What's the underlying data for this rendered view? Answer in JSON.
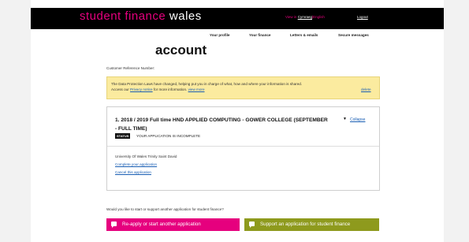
{
  "header": {
    "brand_student_finance": "student finance",
    "brand_wales": "wales",
    "lang_view_in": "View in",
    "lang_cymraeg": "Cymraeg",
    "lang_separator": "|",
    "lang_english": "English",
    "logout": "Logout"
  },
  "nav": {
    "items": [
      "Your profile",
      "Your finance",
      "Letters & emails",
      "Secure messages"
    ]
  },
  "page": {
    "title": "account",
    "crn_label": "Customer Reference Number:"
  },
  "notice": {
    "line1": "The Data Protection Laws have changed, helping put you in charge of what, how and where your information is shared.",
    "line2_prefix": "Access our",
    "privacy_link": "Privacy notice",
    "line2_mid": "for more information.",
    "view_more": "view more",
    "delete": "delete"
  },
  "application": {
    "title_line1": "1. 2018 / 2019 Full time HND APPLIED COMPUTING - GOWER COLLEGE (SEPTEMBER",
    "title_line2": "- FULL TIME)",
    "arrow": "▼",
    "collapse": "Collapse",
    "status_badge": "STATUS",
    "status_text": "YOUR APPLICATION IS INCOMPLETE",
    "university": "University Of Wales Trinity Saint David",
    "complete_link": "Complete your application",
    "cancel_link": "Cancel this application"
  },
  "actions": {
    "question": "Would you like to start or support another application for student finance?",
    "reapply_label": "Re-apply or start another application",
    "support_label": "Support an application for student finance",
    "reapply_color": "#e6007e",
    "support_color": "#8e9a1d",
    "icon": "speech-bubble-icon"
  },
  "colors": {
    "brand_pink": "#e6007e",
    "notice_bg": "#fbeb9f",
    "link_blue": "#1a5fb4"
  }
}
